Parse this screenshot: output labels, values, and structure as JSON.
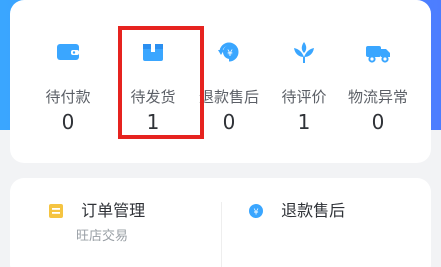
{
  "colors": {
    "accent_blue": "#3aa6ff",
    "highlight_red": "#e6231f",
    "order_icon_yellow": "#f5c441"
  },
  "order_status": {
    "items": [
      {
        "label": "待付款",
        "count": "0",
        "icon": "wallet-icon"
      },
      {
        "label": "待发货",
        "count": "1",
        "icon": "box-icon"
      },
      {
        "label": "退款售后",
        "count": "0",
        "icon": "refund-yen-icon"
      },
      {
        "label": "待评价",
        "count": "1",
        "icon": "flower-icon"
      },
      {
        "label": "物流异常",
        "count": "0",
        "icon": "truck-icon"
      }
    ]
  },
  "quick_links": {
    "order_management": {
      "title": "订单管理",
      "subtitle": "旺店交易",
      "icon": "order-list-icon"
    },
    "refund_aftersale": {
      "title": "退款售后",
      "icon": "refund-yen-icon"
    }
  }
}
